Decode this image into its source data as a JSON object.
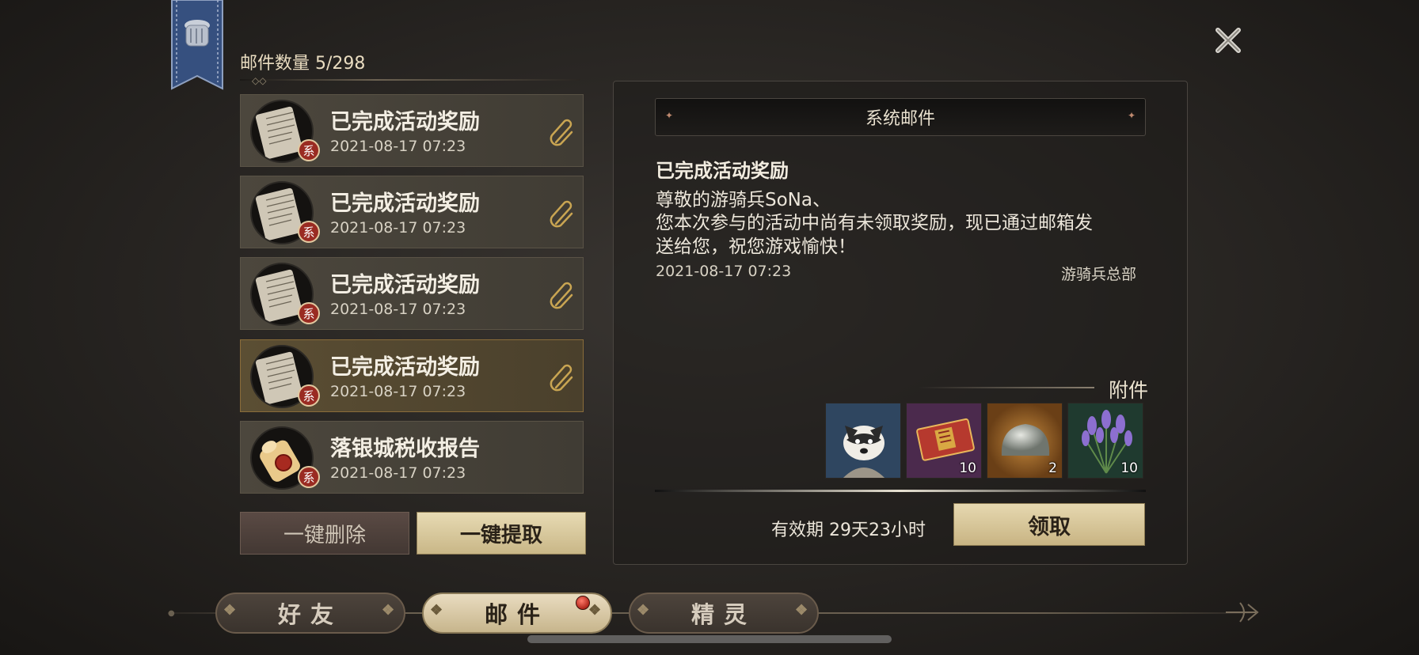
{
  "header": {
    "mail_count_label": "邮件数量",
    "mail_count_value": "5/298"
  },
  "mail_list": [
    {
      "title": "已完成活动奖励",
      "time": "2021-08-17 07:23",
      "badge": "系",
      "icon": "scroll-letter-icon",
      "attachment": true,
      "selected": false
    },
    {
      "title": "已完成活动奖励",
      "time": "2021-08-17 07:23",
      "badge": "系",
      "icon": "scroll-letter-icon",
      "attachment": true,
      "selected": false
    },
    {
      "title": "已完成活动奖励",
      "time": "2021-08-17 07:23",
      "badge": "系",
      "icon": "scroll-letter-icon",
      "attachment": true,
      "selected": false
    },
    {
      "title": "已完成活动奖励",
      "time": "2021-08-17 07:23",
      "badge": "系",
      "icon": "scroll-letter-icon",
      "attachment": true,
      "selected": true
    },
    {
      "title": "落银城税收报告",
      "time": "2021-08-17 07:23",
      "badge": "系",
      "icon": "sealed-scroll-icon",
      "attachment": false,
      "selected": false
    }
  ],
  "list_buttons": {
    "delete_all": "一键删除",
    "extract_all": "一键提取"
  },
  "detail": {
    "header": "系统邮件",
    "title": "已完成活动奖励",
    "body_lines": [
      "尊敬的游骑兵SoNa、",
      "您本次参与的活动中尚有未领取奖励，现已通过邮箱发",
      "送给您，祝您游戏愉快！"
    ],
    "time": "2021-08-17 07:23",
    "sender": "游骑兵总部",
    "attachments_label": "附件",
    "attachments": [
      {
        "icon": "raccoon-avatar-icon",
        "count": ""
      },
      {
        "icon": "red-ticket-icon",
        "count": "10"
      },
      {
        "icon": "silver-ore-icon",
        "count": "2"
      },
      {
        "icon": "lavender-bouquet-icon",
        "count": "10"
      }
    ],
    "validity": "有效期 29天23小时",
    "claim_label": "领取"
  },
  "tabs": [
    {
      "label": "好友",
      "active": false
    },
    {
      "label": "邮件",
      "active": true
    },
    {
      "label": "精灵",
      "active": false
    }
  ],
  "colors": {
    "accent_gold": "#c9b787",
    "badge_red": "#9a2b22",
    "selected_border": "#8a6c3a"
  }
}
